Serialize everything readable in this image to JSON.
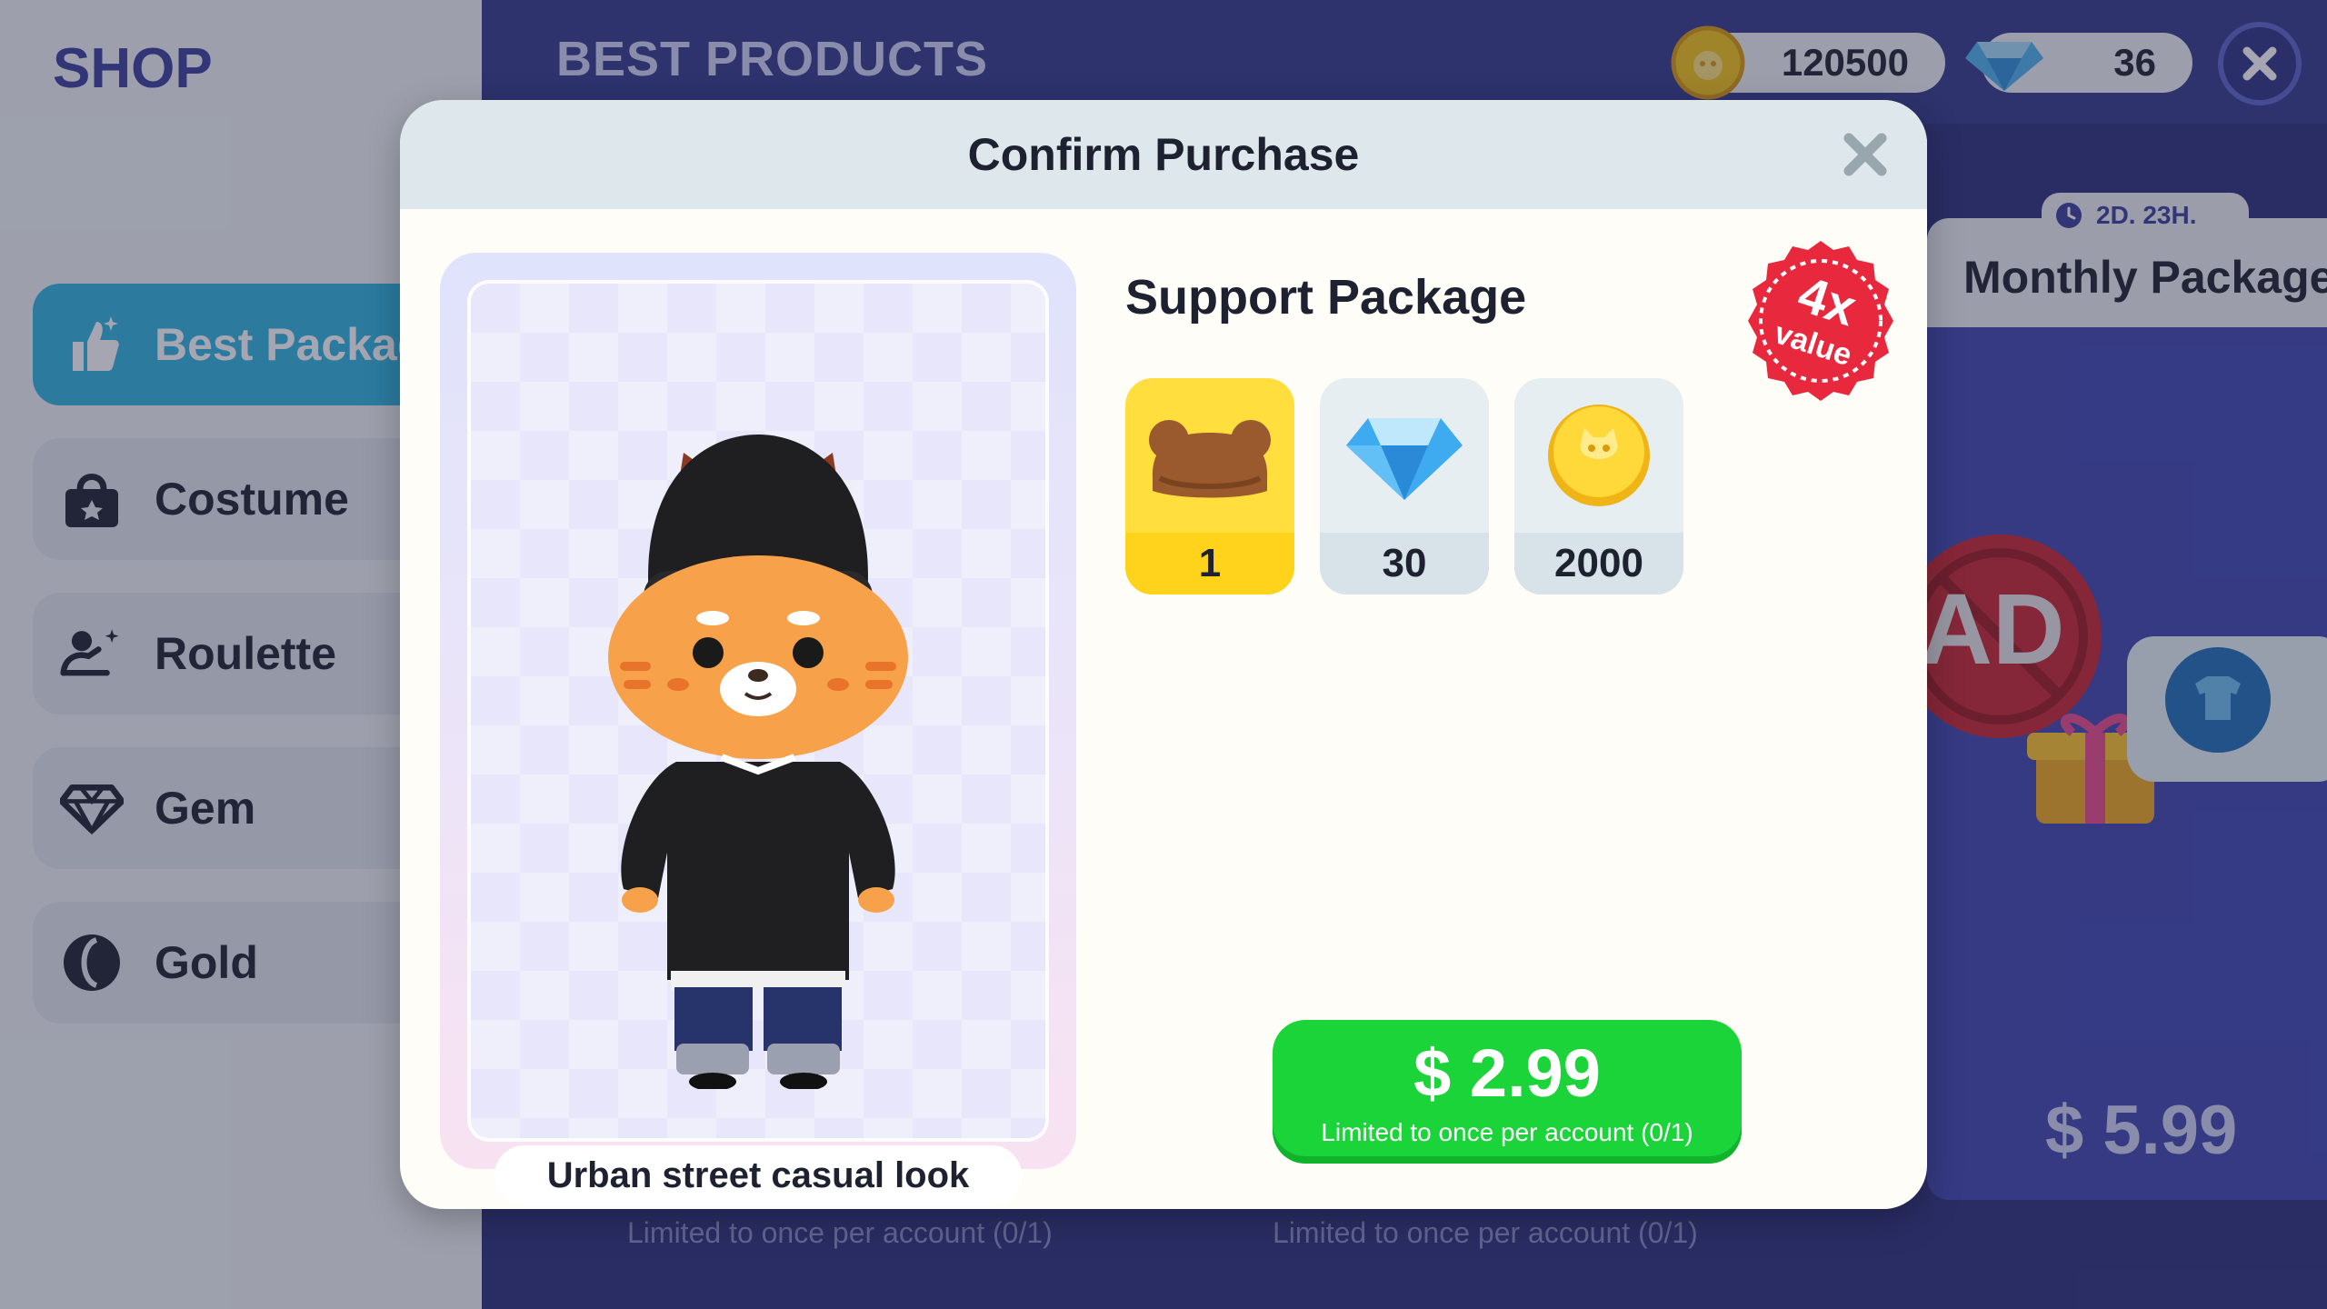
{
  "sidebar": {
    "title": "SHOP",
    "items": [
      {
        "label": "Best Packag",
        "icon": "thumbs-up-icon",
        "active": true
      },
      {
        "label": "Costume",
        "icon": "shopping-bag-icon",
        "active": false
      },
      {
        "label": "Roulette",
        "icon": "hanger-icon",
        "active": false
      },
      {
        "label": "Gem",
        "icon": "gem-icon",
        "active": false
      },
      {
        "label": "Gold",
        "icon": "gold-coin-icon",
        "active": false
      }
    ]
  },
  "header": {
    "title": "BEST PRODUCTS",
    "gold_amount": "120500",
    "gem_amount": "36"
  },
  "background": {
    "monthly_title": "Monthly Package",
    "timer": "2D. 23H.",
    "monthly_price": "$ 5.99",
    "ad_text": "AD",
    "limit_note_left": "Limited to once per account (0/1)",
    "limit_note_right": "Limited to once per account (0/1)"
  },
  "dialog": {
    "title": "Confirm Purchase",
    "package_name": "Support Package",
    "badge_multiplier": "4x",
    "badge_text": "value",
    "look_label": "Urban street casual look",
    "rewards": [
      {
        "icon": "bear-ears-hat-icon",
        "quantity": "1"
      },
      {
        "icon": "gem-icon",
        "quantity": "30"
      },
      {
        "icon": "gold-coin-icon",
        "quantity": "2000"
      }
    ],
    "price": "$ 2.99",
    "limit_note": "Limited to once per account (0/1)"
  },
  "colors": {
    "accent_blue": "#2fb6e0",
    "buy_green": "#1bd43a",
    "badge_red": "#e8283c",
    "gold": "#f5c518"
  }
}
